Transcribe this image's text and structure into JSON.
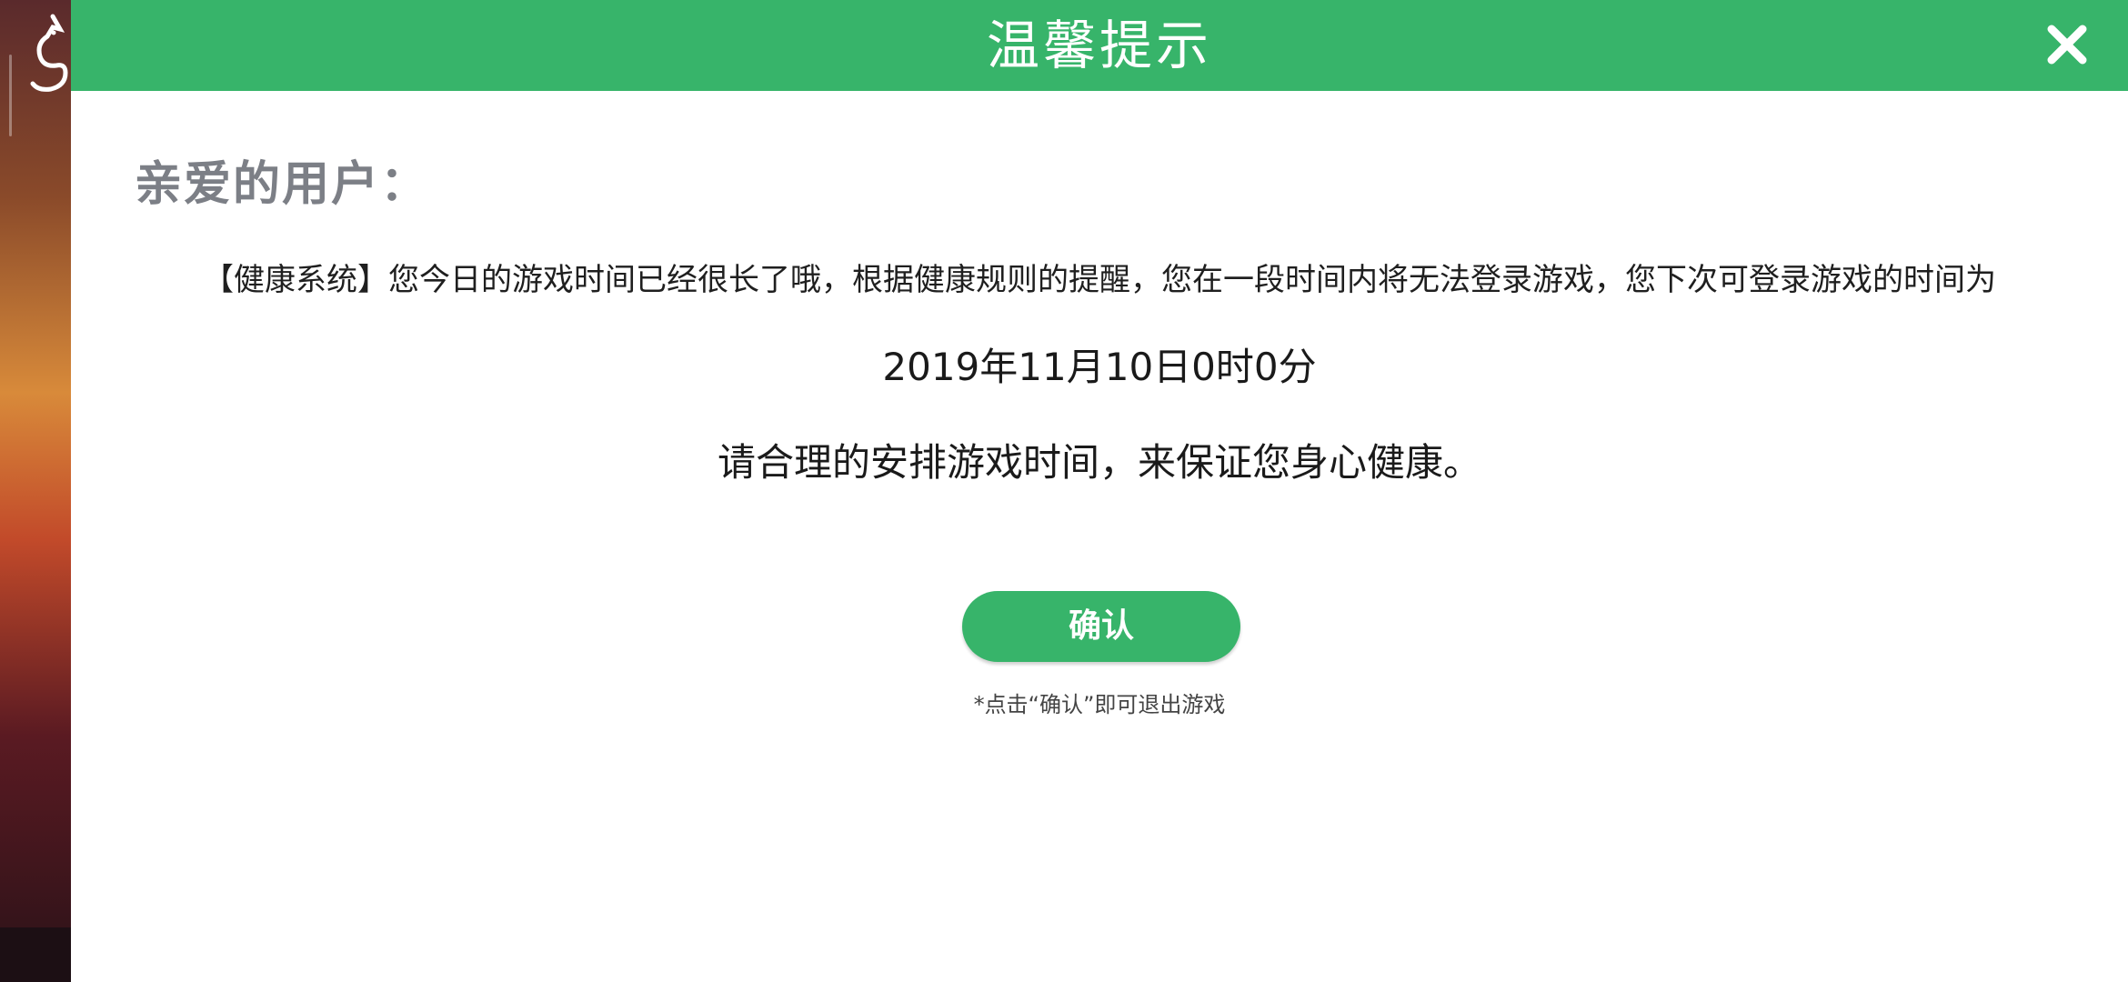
{
  "dialog": {
    "title": "温馨提示",
    "close_icon": "close-icon"
  },
  "content": {
    "greeting": "亲爱的用户：",
    "message": "【健康系统】您今日的游戏时间已经很长了哦，根据健康规则的提醒，您在一段时间内将无法登录游戏，您下次可登录游戏的时间为",
    "next_login_time": "2019年11月10日0时0分",
    "advice": "请合理的安排游戏时间，来保证您身心健康。"
  },
  "actions": {
    "confirm_label": "确认",
    "note": "*点击“确认”即可退出游戏"
  },
  "colors": {
    "accent": "#37b46a",
    "greeting_text": "#7c7f86"
  }
}
